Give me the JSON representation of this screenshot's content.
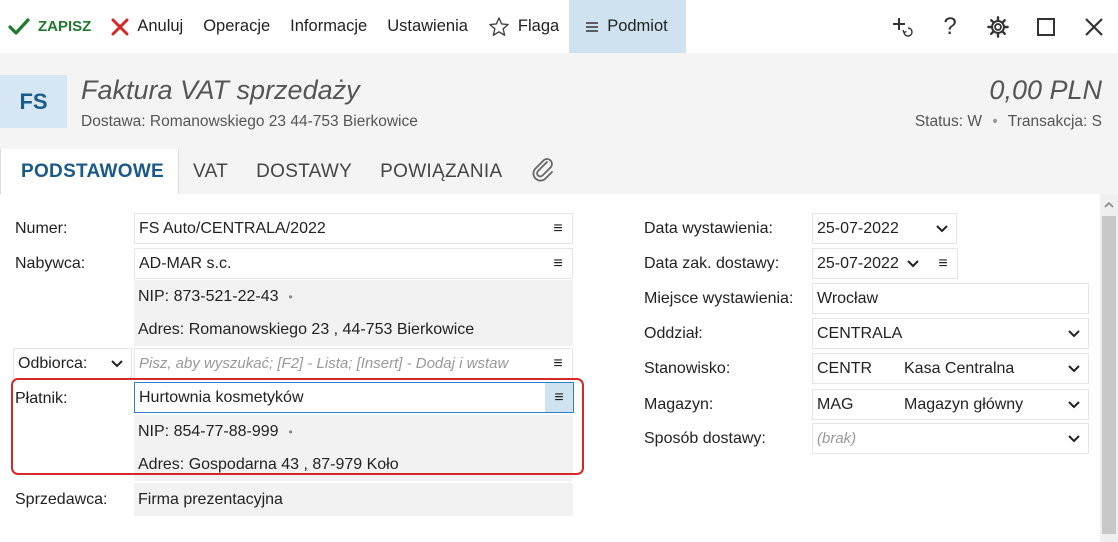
{
  "toolbar": {
    "save_label": "ZAPISZ",
    "cancel_label": "Anuluj",
    "operations_label": "Operacje",
    "info_label": "Informacje",
    "settings_label": "Ustawienia",
    "flag_label": "Flaga",
    "subject_label": "Podmiot",
    "help_label": "?"
  },
  "header": {
    "badge": "FS",
    "title": "Faktura VAT sprzedaży",
    "subtitle": "Dostawa: Romanowskiego 23  44-753 Bierkowice",
    "amount": "0,00 PLN",
    "status_label": "Status:",
    "status_value": "W",
    "transaction_label": "Transakcja:",
    "transaction_value": "S"
  },
  "tabs": [
    {
      "label": "PODSTAWOWE"
    },
    {
      "label": "VAT"
    },
    {
      "label": "DOSTAWY"
    },
    {
      "label": "POWIĄZANIA"
    }
  ],
  "left": {
    "numer_label": "Numer:",
    "numer_value": "FS Auto/CENTRALA/2022",
    "nabywca_label": "Nabywca:",
    "nabywca_value": "AD-MAR s.c.",
    "nabywca_nip": "NIP:  873-521-22-43",
    "nabywca_adres": "Adres:  Romanowskiego 23 , 44-753 Bierkowice",
    "odbiorca_label": "Odbiorca:",
    "odbiorca_placeholder": "Pisz, aby wyszukać; [F2] - Lista; [Insert] - Dodaj i wstaw",
    "platnik_label": "Płatnik:",
    "platnik_value": "Hurtownia kosmetyków",
    "platnik_nip": "NIP:  854-77-88-999",
    "platnik_adres": "Adres:  Gospodarna  43 , 87-979 Koło",
    "sprzedawca_label": "Sprzedawca:",
    "sprzedawca_value": "Firma prezentacyjna"
  },
  "right": {
    "data_wyst_label": "Data wystawienia:",
    "data_wyst_value": "25-07-2022",
    "data_zak_label": "Data zak. dostawy:",
    "data_zak_value": "25-07-2022",
    "miejsce_label": "Miejsce wystawienia:",
    "miejsce_value": "Wrocław",
    "oddzial_label": "Oddział:",
    "oddzial_value": "CENTRALA",
    "stanowisko_label": "Stanowisko:",
    "stanowisko_code": "CENTR",
    "stanowisko_name": "Kasa Centralna",
    "magazyn_label": "Magazyn:",
    "magazyn_code": "MAG",
    "magazyn_name": "Magazyn główny",
    "sposob_label": "Sposób dostawy:",
    "sposob_value": "(brak)"
  },
  "colors": {
    "accent": "#1a5a8a",
    "save_green": "#1f7a2e",
    "cancel_red": "#d62828",
    "highlight_border": "#d62828",
    "active_tab_bg": "#cfe2f0"
  }
}
